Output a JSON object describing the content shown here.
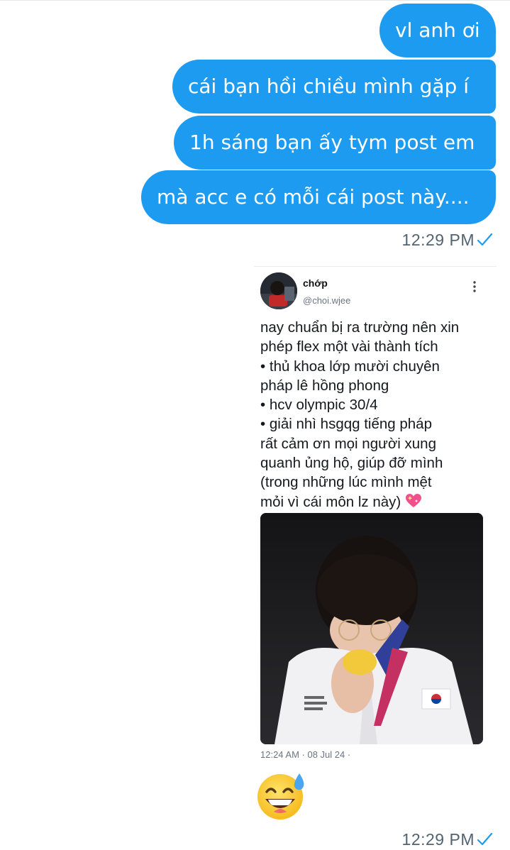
{
  "messages": [
    {
      "text": "vl anh ơi"
    },
    {
      "text": "cái bạn hồi chiều mình gặp í"
    },
    {
      "text": "1h sáng bạn ấy tym post em"
    },
    {
      "text": "mà acc e có mỗi cái post này...."
    }
  ],
  "timestamps": {
    "first": "12:29 PM",
    "second": "12:29 PM"
  },
  "shared_post": {
    "author_name": "chớp",
    "author_handle": "@choi.wjee",
    "body": "nay chuẩn bị ra trường nên xin\nphép flex một vài thành tích\n• thủ khoa lớp mười chuyên\npháp lê hồng phong\n• hcv olympic 30/4\n• giải nhì hsgqg tiếng pháp\nrất cảm ơn mọi người xung\nquanh ủng hộ, giúp đỡ mình\n(trong những lúc mình mệt\nmỏi vì cái môn lz này)",
    "meta": "12:24 AM · 08 Jul 24 ·",
    "emoji": "sparkling-heart-icon"
  },
  "reaction_emoji": "grinning-face-with-sweat-icon",
  "colors": {
    "bubble": "#1d9bf0",
    "timestamp": "#536471",
    "check": "#1d9bf0"
  }
}
